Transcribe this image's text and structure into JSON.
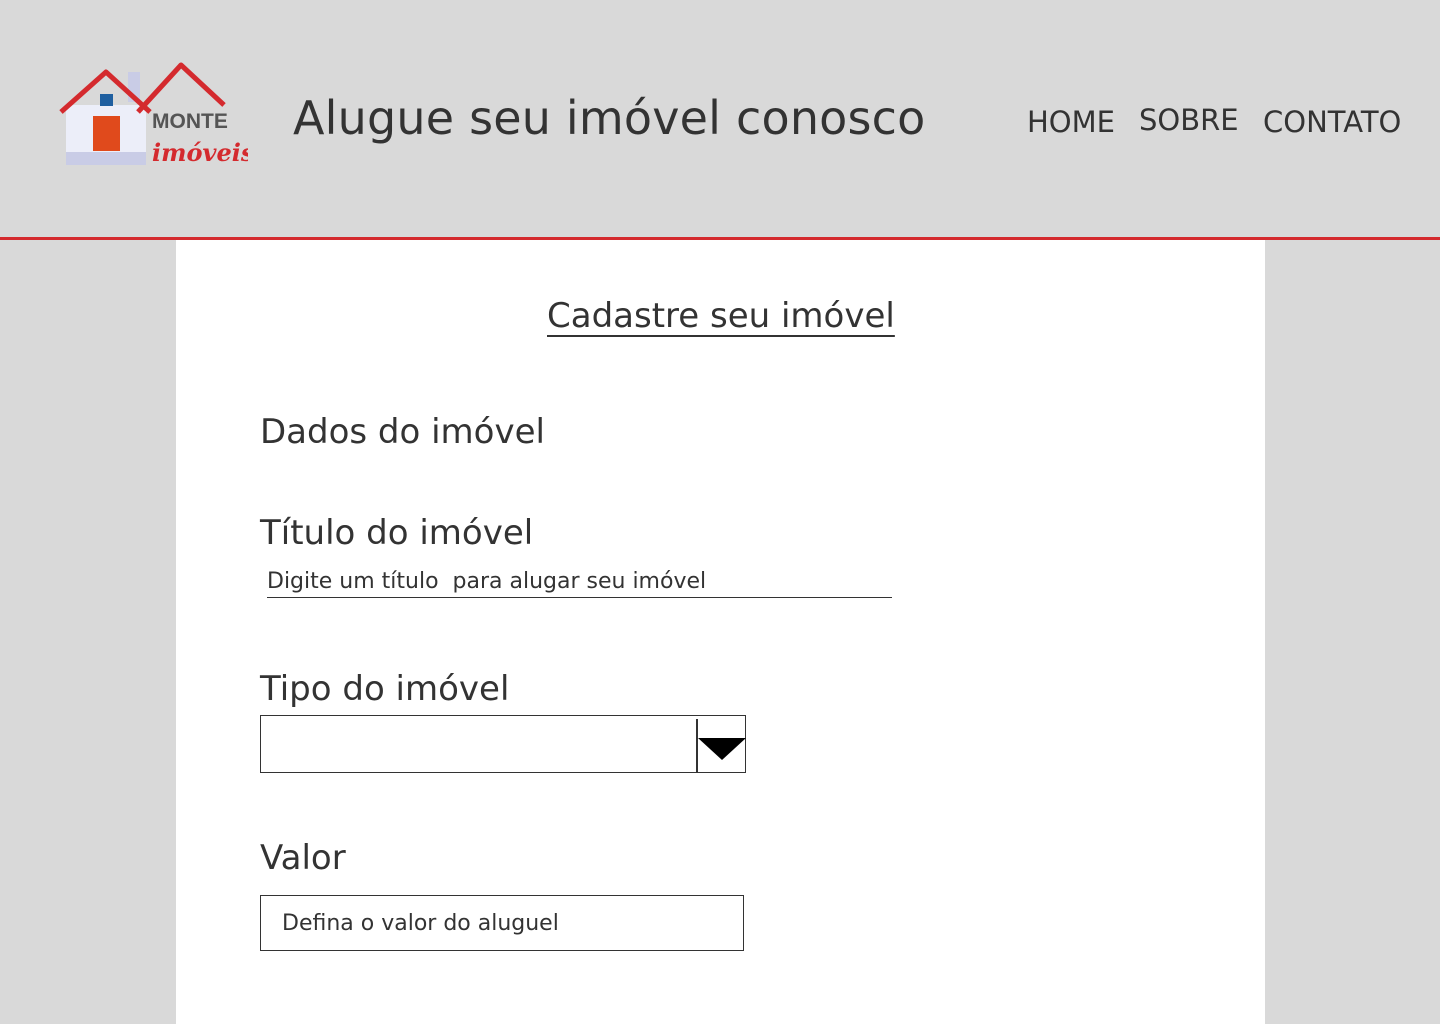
{
  "header": {
    "logo": {
      "brand_top": "MONTE",
      "brand_bottom": "imóveis",
      "roof_color": "#d42a2e",
      "door_color": "#e04a1c",
      "window_color": "#1f5fa0"
    },
    "title": "Alugue seu imóvel conosco",
    "nav": {
      "home": "HOME",
      "sobre": "SOBRE",
      "contato": "CONTATO"
    },
    "accent_color": "#d42a2e"
  },
  "form": {
    "title": "Cadastre seu imóvel",
    "section_title": "Dados do imóvel",
    "titulo": {
      "label": "Título do imóvel",
      "placeholder": "Digite um título  para alugar seu imóvel",
      "value": ""
    },
    "tipo": {
      "label": "Tipo do imóvel",
      "selected": "",
      "icon": "triangle-down-icon"
    },
    "valor": {
      "label": "Valor",
      "placeholder": "Defina o valor do aluguel",
      "value": ""
    }
  }
}
